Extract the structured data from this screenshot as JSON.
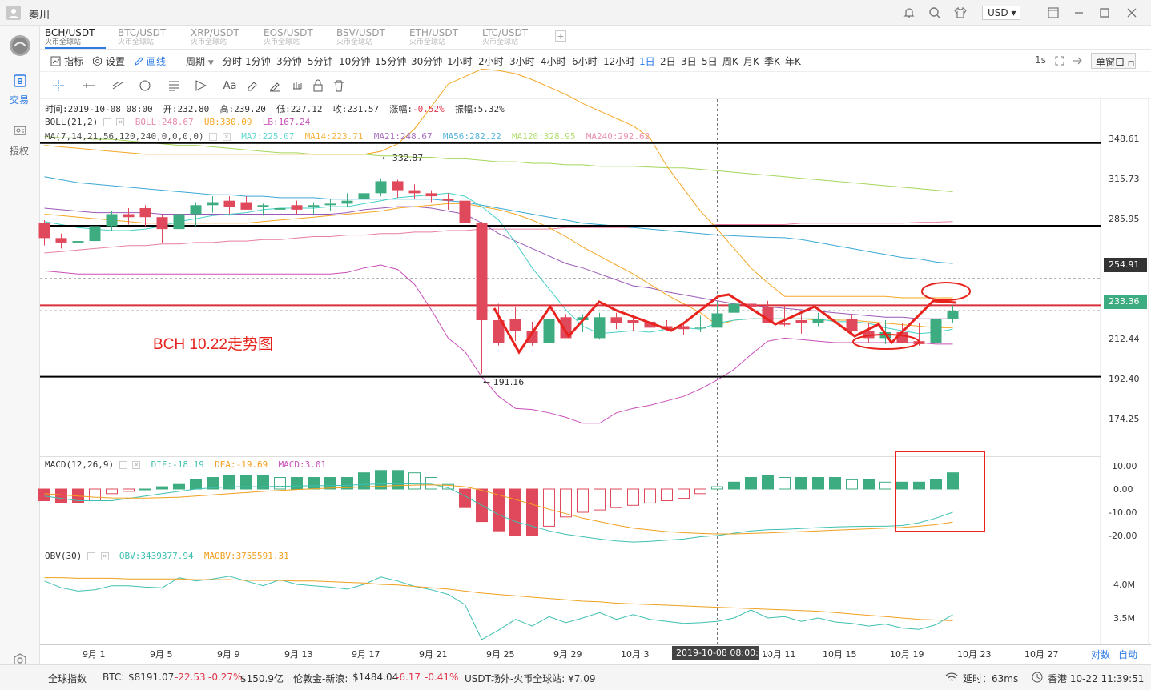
{
  "window": {
    "title": "秦川",
    "currency": "USD"
  },
  "sidebar": {
    "trade": "交易",
    "auth": "授权"
  },
  "tabs": [
    {
      "pair": "BCH/USDT",
      "exchange": "火币全球站",
      "active": true
    },
    {
      "pair": "BTC/USDT",
      "exchange": "火币全球站"
    },
    {
      "pair": "XRP/USDT",
      "exchange": "火币全球站"
    },
    {
      "pair": "EOS/USDT",
      "exchange": "火币全球站"
    },
    {
      "pair": "BSV/USDT",
      "exchange": "火币全球站"
    },
    {
      "pair": "ETH/USDT",
      "exchange": "火币全球站"
    },
    {
      "pair": "LTC/USDT",
      "exchange": "火币全球站"
    }
  ],
  "toolbar": {
    "indicator": "指标",
    "settings": "设置",
    "draw": "画线",
    "period": "周期",
    "periods": [
      "分时",
      "1分钟",
      "3分钟",
      "5分钟",
      "10分钟",
      "15分钟",
      "30分钟",
      "1小时",
      "2小时",
      "3小时",
      "4小时",
      "6小时",
      "12小时",
      "1日",
      "2日",
      "3日",
      "5日",
      "周K",
      "月K",
      "季K",
      "年K"
    ],
    "active_period": "1日",
    "interval": "1s",
    "window_mode": "单窗口"
  },
  "info": {
    "time": "时间:2019-10-08 08:00",
    "open_l": "开:",
    "open": "232.80",
    "high_l": "高:",
    "high": "239.20",
    "low_l": "低:",
    "low": "227.12",
    "close_l": "收:",
    "close": "231.57",
    "change_l": "涨幅:",
    "change": "-0.52%",
    "amp_l": "振幅:",
    "amp": "5.32%"
  },
  "boll": {
    "label": "BOLL(21,2)",
    "boll": "BOLL:248.67",
    "ub": "UB:330.09",
    "lb": "LB:167.24"
  },
  "ma": {
    "label": "MA(7,14,21,56,120,240,0,0,0,0)",
    "ma7": "MA7:225.07",
    "ma14": "MA14:223.71",
    "ma21": "MA21:248.67",
    "ma56": "MA56:282.22",
    "ma120": "MA120:328.95",
    "ma240": "MA240:292.62"
  },
  "macd": {
    "label": "MACD(12,26,9)",
    "dif": "DIF:-18.19",
    "dea": "DEA:-19.69",
    "macd": "MACD:3.01"
  },
  "obv": {
    "label": "OBV(30)",
    "obv": "OBV:3439377.94",
    "maobv": "MAOBV:3755591.31"
  },
  "annotations": {
    "title": "BCH 10.22走势图",
    "high": "← 332.87",
    "low": "← 191.16"
  },
  "price_axis": {
    "ticks": [
      "348.61",
      "315.73",
      "285.95",
      "254.91",
      "233.36",
      "212.44",
      "192.40",
      "174.25"
    ],
    "tag_dashed": "254.91",
    "tag_current": "233.36"
  },
  "macd_axis": [
    "10.00",
    "0.00",
    "-10.00",
    "-20.00"
  ],
  "obv_axis": [
    "4.0M",
    "3.5M"
  ],
  "date_axis": {
    "labels": [
      "9月 1",
      "9月 5",
      "9月 9",
      "9月 13",
      "9月 17",
      "9月 21",
      "9月 25",
      "9月 29",
      "10月 3",
      "10月 11",
      "10月 15",
      "10月 19",
      "10月 23",
      "10月 27"
    ],
    "cursor": "2019-10-08 08:00:00",
    "log": "对数",
    "auto": "自动"
  },
  "status": {
    "index": "全球指数",
    "btc_l": "BTC:",
    "btc": "$8191.07",
    "btc_ch": "-22.53",
    "btc_pct": "-0.27%",
    "btc_vol": "$150.9亿",
    "gold_l": "伦敦金-新浪:",
    "gold": "$1484.04",
    "gold_ch": "-6.17",
    "gold_pct": "-0.41%",
    "usdt": "USDT场外-火币全球站: ¥7.09",
    "latency": "延时：63ms",
    "clock": "香港 10-22 11:39:51"
  },
  "chart_data": {
    "type": "candlestick",
    "pair": "BCH/USDT",
    "dates": [
      "08-29",
      "08-30",
      "08-31",
      "09-01",
      "09-02",
      "09-03",
      "09-04",
      "09-05",
      "09-06",
      "09-07",
      "09-08",
      "09-09",
      "09-10",
      "09-11",
      "09-12",
      "09-13",
      "09-14",
      "09-15",
      "09-16",
      "09-17",
      "09-18",
      "09-19",
      "09-20",
      "09-21",
      "09-22",
      "09-23",
      "09-24",
      "09-25",
      "09-26",
      "09-27",
      "09-28",
      "09-29",
      "09-30",
      "10-01",
      "10-02",
      "10-03",
      "10-04",
      "10-05",
      "10-06",
      "10-07",
      "10-08",
      "10-09",
      "10-10",
      "10-11",
      "10-12",
      "10-13",
      "10-14",
      "10-15",
      "10-16",
      "10-17",
      "10-18",
      "10-19",
      "10-20",
      "10-21",
      "10-22"
    ],
    "open": [
      292,
      282,
      279,
      280,
      290,
      298,
      302,
      296,
      288,
      298,
      304,
      307,
      306,
      303,
      301,
      304,
      303,
      304,
      305,
      308,
      312,
      320,
      314,
      312,
      308,
      307,
      292,
      227,
      228,
      220,
      212,
      229,
      227,
      215,
      229,
      227,
      226,
      223,
      223,
      222,
      222,
      232,
      238,
      236,
      225,
      227,
      225,
      228,
      228,
      220,
      215,
      219,
      213,
      212,
      228
    ],
    "high": [
      294,
      285,
      282,
      292,
      300,
      302,
      304,
      298,
      300,
      306,
      310,
      310,
      310,
      305,
      307,
      307,
      306,
      308,
      312,
      332.87,
      322,
      321,
      318,
      314,
      312,
      308,
      293,
      238,
      236,
      226,
      229,
      231,
      231,
      232,
      232,
      230,
      229,
      227,
      226,
      230,
      239.2,
      241,
      242,
      240,
      237,
      231,
      232,
      235,
      231,
      225,
      227,
      225,
      225,
      230,
      237
    ],
    "low": [
      277,
      275,
      272,
      278,
      287,
      291,
      290,
      279,
      284,
      290,
      299,
      298,
      301,
      297,
      296,
      298,
      298,
      300,
      303,
      305,
      310,
      309,
      308,
      306,
      301,
      291,
      191.16,
      210,
      213,
      210,
      211,
      218,
      219,
      214,
      221,
      220,
      218,
      220,
      217,
      219,
      227.12,
      228,
      228,
      225,
      223,
      218,
      223,
      224,
      218,
      212,
      211,
      213,
      210,
      210,
      225
    ],
    "close": [
      282,
      279,
      280,
      290,
      298,
      296,
      296,
      288,
      298,
      304,
      306,
      303,
      301,
      304,
      302,
      301,
      304,
      305,
      307,
      312,
      320,
      314,
      312,
      310,
      307,
      292,
      227,
      212,
      220,
      212,
      228,
      215,
      229,
      229,
      225,
      225,
      222,
      221,
      221,
      222,
      231.57,
      238,
      236,
      225,
      224,
      225,
      228,
      228,
      220,
      215,
      219,
      212,
      211,
      228,
      233.36
    ],
    "boll": {
      "ub": [
        344,
        343,
        342,
        341,
        340,
        339,
        338,
        338,
        338,
        338,
        338,
        338,
        338,
        338,
        338,
        338,
        338,
        338,
        338,
        338,
        340,
        345,
        355,
        370,
        385,
        390,
        395,
        394,
        392,
        388,
        383,
        378,
        372,
        367,
        362,
        357,
        349,
        330.09,
        315,
        300,
        288,
        275,
        262,
        252,
        243,
        243,
        243,
        243,
        243,
        243,
        243,
        242,
        242,
        242,
        242
      ],
      "mid": [
        302,
        301,
        300,
        299,
        299,
        299,
        299,
        298,
        298,
        298,
        298,
        298,
        298,
        298,
        298,
        298,
        298,
        298,
        299,
        301,
        302,
        303,
        303,
        302,
        300,
        298,
        292,
        285,
        280,
        275,
        270,
        265,
        262,
        258,
        254,
        250,
        248.67,
        246,
        244,
        242,
        240,
        238,
        237,
        236,
        235,
        234,
        233,
        232,
        231,
        230,
        229,
        229,
        228,
        228,
        228
      ],
      "lb": [
        260,
        259,
        258,
        258,
        258,
        258,
        258,
        258,
        258,
        258,
        258,
        258,
        258,
        258,
        258,
        258,
        258,
        258,
        259,
        262,
        264,
        261,
        251,
        234,
        215,
        206,
        189,
        176,
        168,
        167.24,
        165,
        162,
        158,
        158,
        165,
        168,
        170,
        173,
        176,
        181,
        187,
        194,
        204,
        213,
        215,
        214,
        213,
        212,
        212,
        212,
        212,
        212,
        212,
        211,
        211
      ]
    },
    "ma": {
      "ma7": [
        293,
        291,
        289,
        288,
        287,
        287,
        288,
        290,
        293,
        295,
        297,
        298,
        299,
        301,
        302,
        302,
        302,
        303,
        303,
        305,
        307,
        309,
        310,
        311,
        312,
        310,
        303,
        294,
        279,
        262,
        248,
        234,
        223,
        218,
        219,
        220,
        219,
        221,
        222,
        221,
        225.07,
        227,
        228,
        228,
        228,
        228,
        228,
        226,
        226,
        225,
        222,
        220,
        218,
        219,
        221
      ],
      "ma14": [
        298,
        297,
        296,
        295,
        294,
        293,
        292,
        292,
        292,
        292,
        292,
        292,
        292,
        293,
        294,
        295,
        296,
        297,
        298,
        299,
        300,
        302,
        303,
        304,
        305,
        305,
        303,
        301,
        298,
        294,
        289,
        283,
        276,
        270,
        264,
        258,
        251,
        244,
        238,
        232,
        223.71,
        227,
        228,
        228,
        228,
        228,
        227,
        227,
        227,
        226,
        225,
        224,
        223,
        222,
        222
      ],
      "ma56": [
        323,
        321,
        319,
        318,
        317,
        316,
        315,
        314,
        313,
        312,
        311,
        311,
        310,
        310,
        309,
        309,
        309,
        308,
        308,
        308,
        308,
        308,
        308,
        308,
        307,
        306,
        304,
        302,
        300,
        298,
        296,
        294,
        292,
        291,
        290,
        289,
        288,
        287,
        286,
        285,
        284,
        283.5,
        283,
        282.5,
        282.22,
        281,
        279,
        277,
        275,
        273,
        271,
        269,
        268,
        266,
        265
      ],
      "ma120": [
        350,
        349,
        349,
        348,
        348,
        347,
        346,
        345,
        344,
        344,
        343,
        342,
        341,
        340,
        339,
        339,
        338,
        338,
        338,
        338,
        337,
        337,
        336,
        336,
        335,
        335,
        334,
        333,
        333,
        332,
        332,
        331,
        331,
        330,
        330,
        330,
        329.5,
        329,
        328.95,
        328,
        327,
        326,
        325,
        324,
        323,
        322,
        321,
        320,
        319,
        318,
        317,
        316,
        315,
        314,
        313
      ],
      "ma240": [
        272,
        273,
        274,
        275,
        276,
        277,
        277,
        278,
        278,
        279,
        279,
        280,
        280,
        281,
        281,
        282,
        283,
        283,
        284,
        284,
        285,
        285,
        286,
        286,
        287,
        287,
        288,
        288,
        288,
        288,
        288,
        289,
        289,
        289,
        289,
        289,
        290,
        290,
        290,
        290,
        291,
        291,
        291,
        291,
        291,
        292,
        292,
        292,
        292,
        292,
        292,
        292,
        292.5,
        292.62,
        293
      ]
    },
    "macd": {
      "dif": [
        -3,
        -4,
        -5,
        -5,
        -5,
        -4,
        -3,
        -2,
        -1,
        0,
        0.5,
        1,
        1,
        1,
        1.2,
        1.3,
        1.4,
        1.5,
        1.6,
        2,
        2.2,
        2.3,
        2.2,
        2.1,
        0.5,
        -3,
        -7,
        -11,
        -14,
        -16,
        -18,
        -19.5,
        -20.5,
        -21.5,
        -22.3,
        -22.8,
        -22.5,
        -22,
        -21.5,
        -20.5,
        -20,
        -19,
        -18,
        -17.5,
        -17.3,
        -17,
        -16.6,
        -16.3,
        -16.1,
        -16,
        -16,
        -15.7,
        -14.5,
        -12.5,
        -10
      ],
      "dea": [
        -2,
        -2.5,
        -3,
        -3.5,
        -3.8,
        -3.9,
        -3.9,
        -3.7,
        -3.5,
        -3,
        -2.5,
        -2,
        -1.5,
        -1,
        -0.6,
        -0.2,
        0.1,
        0.4,
        0.6,
        0.9,
        1.2,
        1.5,
        1.7,
        1.8,
        1.6,
        1,
        -0.5,
        -2.5,
        -4.5,
        -6.6,
        -8.7,
        -10.6,
        -12.5,
        -14,
        -15.5,
        -16.8,
        -17.6,
        -18.3,
        -18.8,
        -19.1,
        -19.3,
        -19.3,
        -19.1,
        -18.9,
        -18.6,
        -18.3,
        -18,
        -17.7,
        -17.4,
        -17.1,
        -16.8,
        -16.5,
        -16,
        -15.3,
        -14.2
      ],
      "hist": [
        -5,
        -6,
        -6,
        -5,
        -2,
        -1,
        0,
        1,
        2,
        4,
        5,
        6,
        6,
        6,
        5,
        5,
        5,
        5,
        5,
        7,
        8,
        8,
        7,
        5,
        2,
        -8,
        -14,
        -18,
        -20,
        -20,
        -16,
        -12,
        -10,
        -9,
        -8,
        -7,
        -6,
        -5,
        -4,
        -2,
        1,
        3,
        5,
        6,
        5,
        5,
        5,
        5,
        4,
        4,
        3,
        3,
        3,
        4,
        7
      ]
    },
    "obv": {
      "obv": [
        4.05,
        3.95,
        3.9,
        3.92,
        3.98,
        3.98,
        3.96,
        3.95,
        4.1,
        4.05,
        4.08,
        4.12,
        4.05,
        3.98,
        4.07,
        4.0,
        3.98,
        3.96,
        3.93,
        4.0,
        4.11,
        4.05,
        3.97,
        3.92,
        3.85,
        3.7,
        3.18,
        3.32,
        3.48,
        3.38,
        3.52,
        3.43,
        3.5,
        3.58,
        3.48,
        3.55,
        3.48,
        3.45,
        3.42,
        3.43,
        3.45,
        3.5,
        3.62,
        3.5,
        3.52,
        3.45,
        3.5,
        3.44,
        3.42,
        3.38,
        3.41,
        3.35,
        3.33,
        3.4,
        3.55
      ],
      "maobv": [
        4.1,
        4.1,
        4.09,
        4.09,
        4.09,
        4.08,
        4.08,
        4.08,
        4.08,
        4.07,
        4.07,
        4.07,
        4.06,
        4.06,
        4.06,
        4.05,
        4.05,
        4.04,
        4.03,
        4.02,
        4.0,
        3.99,
        3.97,
        3.95,
        3.93,
        3.9,
        3.87,
        3.85,
        3.83,
        3.81,
        3.79,
        3.77,
        3.75,
        3.74,
        3.72,
        3.71,
        3.7,
        3.69,
        3.68,
        3.67,
        3.66,
        3.65,
        3.64,
        3.63,
        3.62,
        3.61,
        3.6,
        3.58,
        3.56,
        3.54,
        3.52,
        3.5,
        3.48,
        3.47,
        3.46
      ]
    },
    "horizontal_lines": [
      {
        "price": 345.5,
        "color": "#000000"
      },
      {
        "price": 290.2,
        "color": "#000000"
      },
      {
        "price": 237.0,
        "color": "#d9303a"
      },
      {
        "price": 189.2,
        "color": "#000000"
      }
    ],
    "colors": {
      "up": "#3dac80",
      "down": "#e0495b",
      "ub": "#f5a623",
      "boll": "#e88bb0",
      "lb": "#c94fb8",
      "ma7": "#46d0c8",
      "ma14": "#f5a623",
      "ma21": "#9b59b6",
      "ma56": "#3aa9d6",
      "ma120": "#a5d65a",
      "ma240": "#e87fa0",
      "dif": "#3fc0b0",
      "dea": "#f0a020",
      "obv": "#3fc0b0",
      "maobv": "#f0a020",
      "annotation": "#e8231e"
    }
  }
}
